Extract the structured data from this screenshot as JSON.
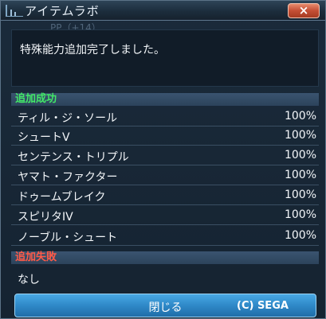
{
  "window": {
    "title": "アイテムラボ",
    "close_label": "×"
  },
  "ghost_text": "PP（+14）",
  "message": "特殊能力追加完了しました。",
  "success": {
    "header": "追加成功",
    "items": [
      {
        "name": "ティル・ジ・ソール",
        "rate": "100%"
      },
      {
        "name": "シュートV",
        "rate": "100%"
      },
      {
        "name": "センテンス・トリプル",
        "rate": "100%"
      },
      {
        "name": "ヤマト・ファクター",
        "rate": "100%"
      },
      {
        "name": "ドゥームブレイク",
        "rate": "100%"
      },
      {
        "name": "スピリタIV",
        "rate": "100%"
      },
      {
        "name": "ノーブル・シュート",
        "rate": "100%"
      }
    ]
  },
  "failure": {
    "header": "追加失敗",
    "none_label": "なし"
  },
  "footer": {
    "close_button": "閉じる",
    "copyright": "(C) SEGA"
  }
}
